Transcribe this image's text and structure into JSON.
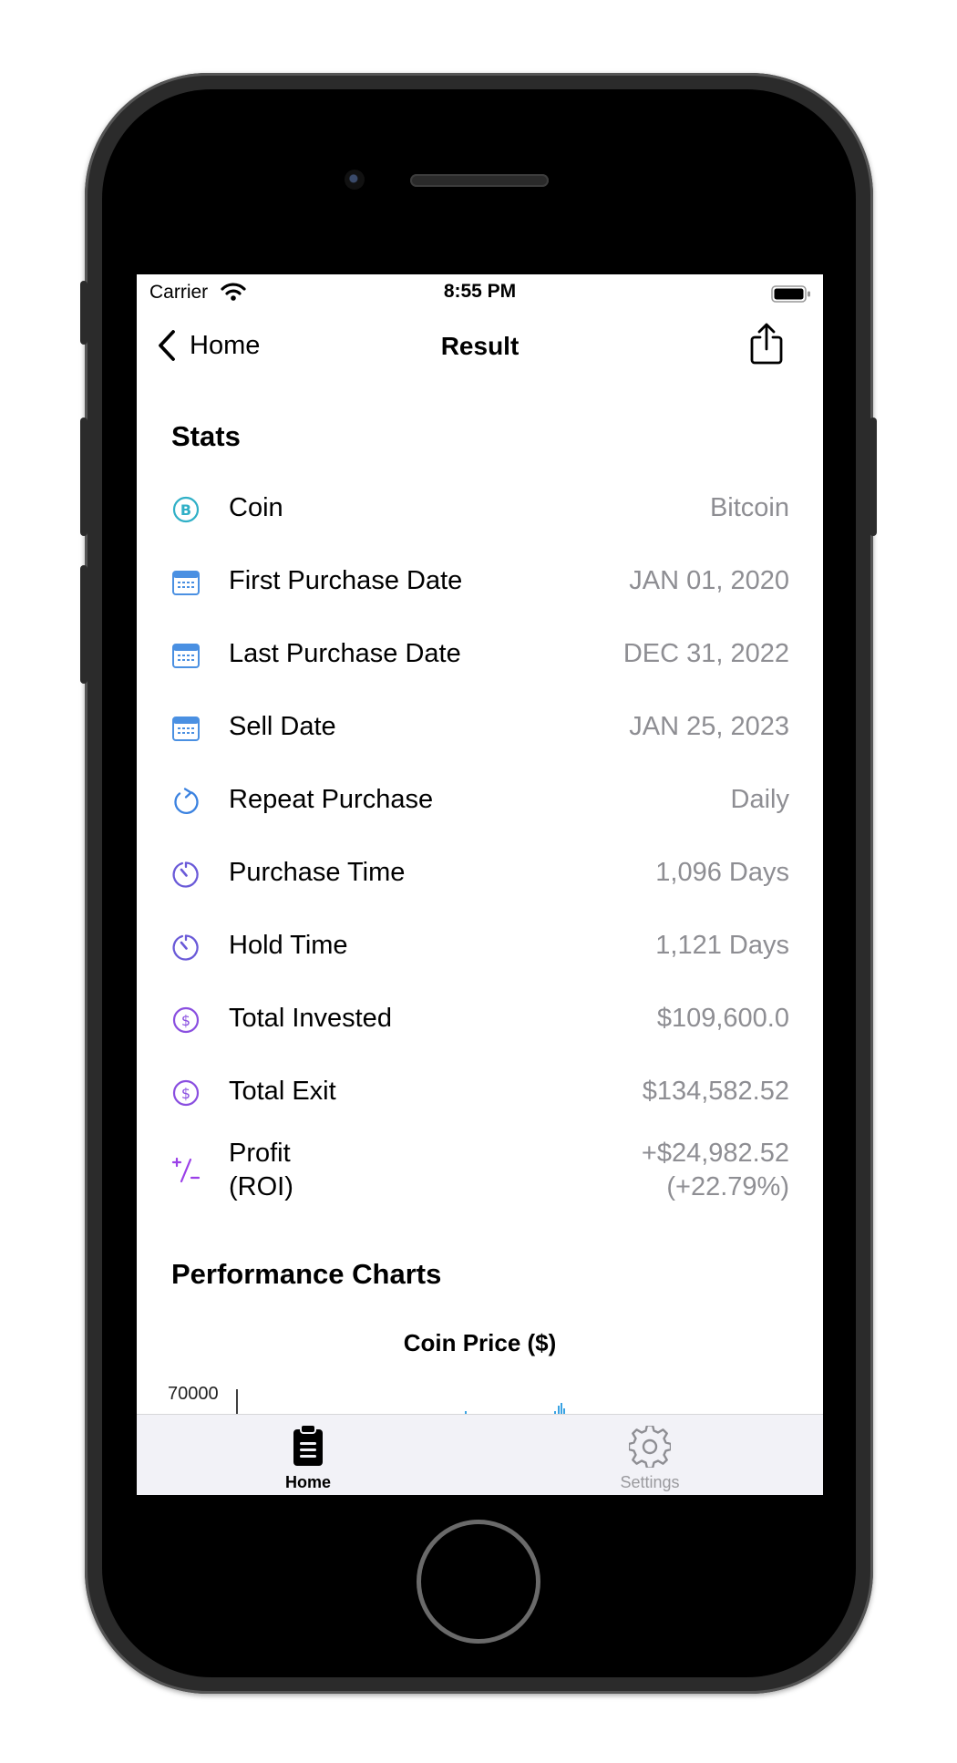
{
  "status_bar": {
    "carrier": "Carrier",
    "time": "8:55 PM"
  },
  "nav": {
    "back_label": "Home",
    "title": "Result"
  },
  "stats": {
    "title": "Stats",
    "rows": [
      {
        "label": "Coin",
        "value": "Bitcoin",
        "icon": "bitcoin-icon"
      },
      {
        "label": "First Purchase Date",
        "value": "JAN 01, 2020",
        "icon": "calendar-icon"
      },
      {
        "label": "Last Purchase Date",
        "value": "DEC 31, 2022",
        "icon": "calendar-icon"
      },
      {
        "label": "Sell Date",
        "value": "JAN 25, 2023",
        "icon": "calendar-icon"
      },
      {
        "label": "Repeat Purchase",
        "value": "Daily",
        "icon": "repeat-arrow-icon"
      },
      {
        "label": "Purchase Time",
        "value": "1,096 Days",
        "icon": "timer-icon"
      },
      {
        "label": "Hold Time",
        "value": "1,121 Days",
        "icon": "timer-icon"
      },
      {
        "label": "Total Invested",
        "value": "$109,600.0",
        "icon": "dollar-circle-icon"
      },
      {
        "label": "Total Exit",
        "value": "$134,582.52",
        "icon": "dollar-circle-icon"
      }
    ],
    "profit": {
      "label_line1": "Profit",
      "label_line2": "(ROI)",
      "value_line1": "+$24,982.52",
      "value_line2": "(+22.79%)",
      "icon": "plus-minus-icon"
    }
  },
  "charts": {
    "title": "Performance Charts",
    "chart_data": {
      "type": "bar",
      "title": "Coin Price ($)",
      "y_ticks": [
        "70000"
      ]
    }
  },
  "tabs": [
    {
      "label": "Home",
      "icon": "clipboard-icon",
      "selected": true
    },
    {
      "label": "Settings",
      "icon": "gear-icon",
      "selected": false
    }
  ],
  "colors": {
    "coin_icon": "#30b0c7",
    "calendar_icon": "#4a90e2",
    "timer_icon": "#6a5ad8",
    "dollar_icon": "#8a4fe0",
    "value_gray": "#8e8e93",
    "chart_bar": "#3aa3e3"
  }
}
